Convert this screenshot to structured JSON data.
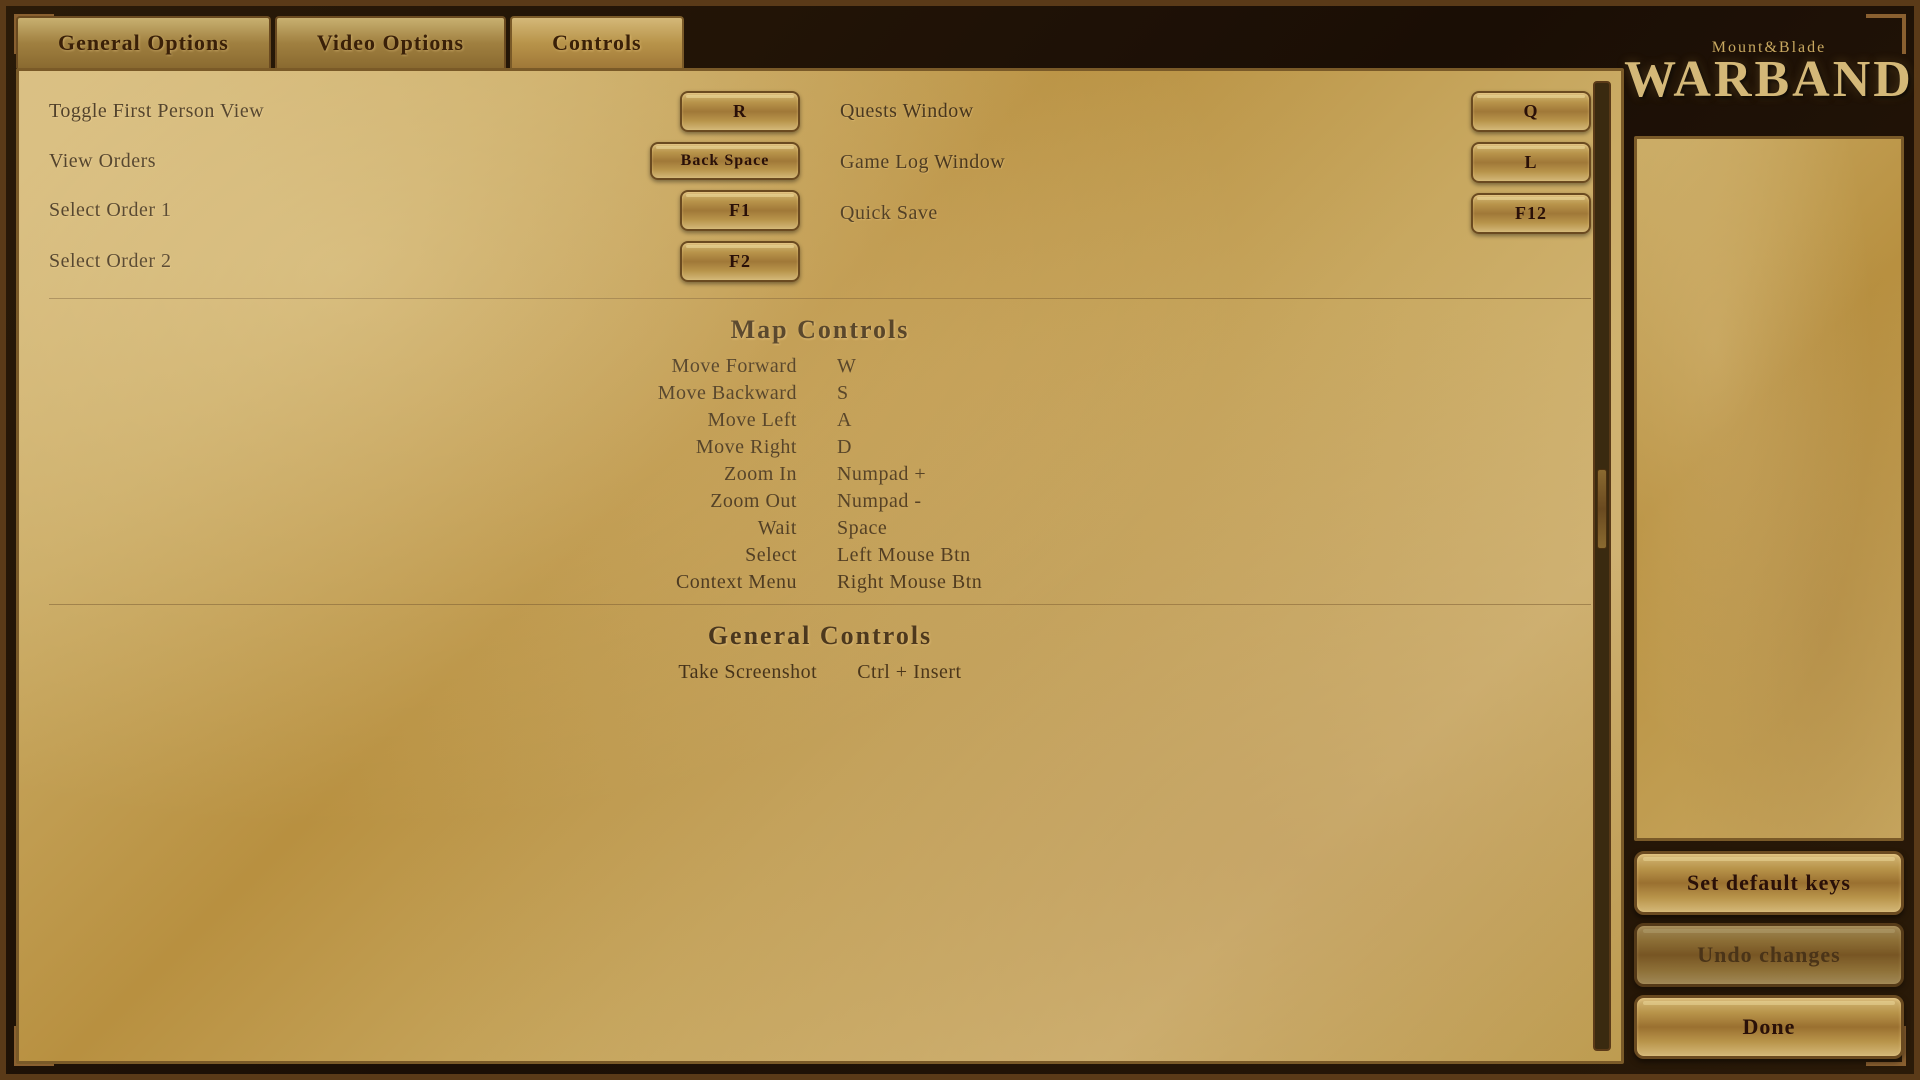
{
  "tabs": [
    {
      "id": "general",
      "label": "General Options",
      "active": false
    },
    {
      "id": "video",
      "label": "Video Options",
      "active": false
    },
    {
      "id": "controls",
      "label": "Controls",
      "active": true
    }
  ],
  "controls_section": {
    "top_left": [
      {
        "label": "Toggle First Person View",
        "key": "R"
      },
      {
        "label": "View Orders",
        "key": "Back Space"
      },
      {
        "label": "Select Order 1",
        "key": "F1"
      },
      {
        "label": "Select Order 2",
        "key": "F2"
      }
    ],
    "top_right": [
      {
        "label": "Quests Window",
        "key": "Q"
      },
      {
        "label": "Game Log Window",
        "key": "L"
      },
      {
        "label": "Quick Save",
        "key": "F12"
      }
    ]
  },
  "map_controls": {
    "title": "Map Controls",
    "rows": [
      {
        "label": "Move Forward",
        "key": "W"
      },
      {
        "label": "Move Backward",
        "key": "S"
      },
      {
        "label": "Move Left",
        "key": "A"
      },
      {
        "label": "Move Right",
        "key": "D"
      },
      {
        "label": "Zoom In",
        "key": "Numpad +"
      },
      {
        "label": "Zoom Out",
        "key": "Numpad -"
      },
      {
        "label": "Wait",
        "key": "Space"
      },
      {
        "label": "Select",
        "key": "Left Mouse Btn"
      },
      {
        "label": "Context Menu",
        "key": "Right Mouse Btn"
      }
    ]
  },
  "general_controls": {
    "title": "General Controls",
    "rows": [
      {
        "label": "Take Screenshot",
        "key": "Ctrl + Insert"
      }
    ]
  },
  "logo": {
    "top": "Mount&Blade",
    "bottom": "WARBAND"
  },
  "buttons": {
    "set_default": "Set default keys",
    "undo": "Undo changes",
    "done": "Done"
  }
}
